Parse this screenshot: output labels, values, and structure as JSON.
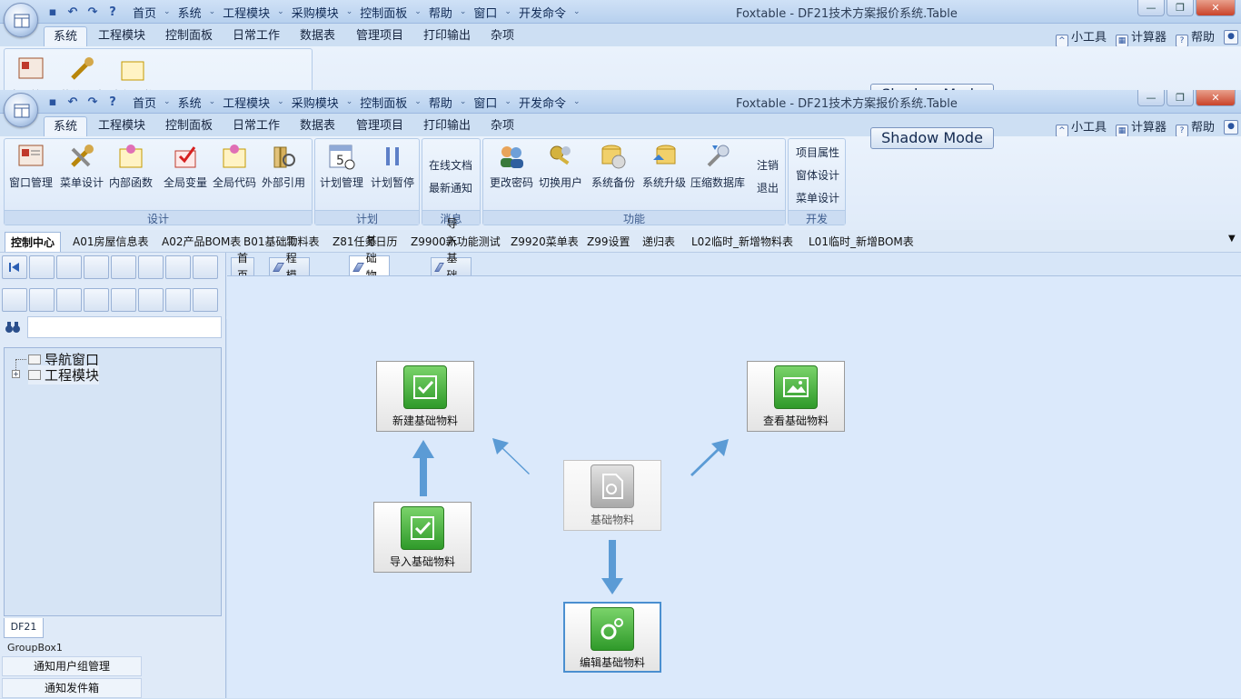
{
  "window": {
    "title": "Foxtable - DF21技术方案报价系统.Table",
    "quick_menu": [
      "首页",
      "系统",
      "工程模块",
      "采购模块",
      "控制面板",
      "帮助",
      "窗口",
      "开发命令"
    ],
    "minimize": "—",
    "restore": "❐",
    "close": "✕"
  },
  "ribbon": {
    "tabs": [
      "系统",
      "工程模块",
      "控制面板",
      "日常工作",
      "数据表",
      "管理项目",
      "打印输出",
      "杂项"
    ],
    "right_tools": [
      "小工具",
      "计算器",
      "帮助"
    ],
    "shadow_mode": "Shadow Mode",
    "groups": {
      "design": {
        "caption": "设计",
        "buttons": [
          "窗口管理",
          "菜单设计",
          "内部函数",
          "全局变量",
          "全局代码",
          "外部引用"
        ]
      },
      "plan": {
        "caption": "计划",
        "buttons": [
          "计划管理",
          "计划暂停"
        ]
      },
      "message": {
        "caption": "消息",
        "items": [
          "在线文档",
          "最新通知"
        ]
      },
      "function": {
        "caption": "功能",
        "buttons": [
          "更改密码",
          "切换用户",
          "系统备份",
          "系统升级",
          "压缩数据库"
        ],
        "items": [
          "注销",
          "退出"
        ]
      },
      "develop": {
        "caption": "开发",
        "items": [
          "项目属性",
          "窗体设计",
          "菜单设计"
        ]
      }
    }
  },
  "doc_tabs": [
    "控制中心",
    "A01房屋信息表",
    "A02产品BOM表",
    "B01基础物料表",
    "Z81任务日历",
    "Z9900新功能测试",
    "Z9920菜单表",
    "Z99设置",
    "递归表",
    "L02临时_新增物料表",
    "L01临时_新增BOM表"
  ],
  "left_pane": {
    "search_placeholder": "",
    "tree": [
      "导航窗口",
      "工程模块"
    ],
    "tab_label": "DF21",
    "groupbox_label": "GroupBox1",
    "buttons": [
      "通知用户组管理",
      "通知发件箱"
    ]
  },
  "page_tabs": [
    "首页",
    "工程模块",
    "基础物料",
    "导入基础物料"
  ],
  "flow": {
    "new": "新建基础物料",
    "view": "查看基础物料",
    "center": "基础物料",
    "import": "导入基础物料",
    "edit": "编辑基础物料"
  },
  "colors": {
    "accent": "#4a8fd0",
    "tile_green": "#3aa533",
    "arrow_blue": "#5b9bd5"
  }
}
